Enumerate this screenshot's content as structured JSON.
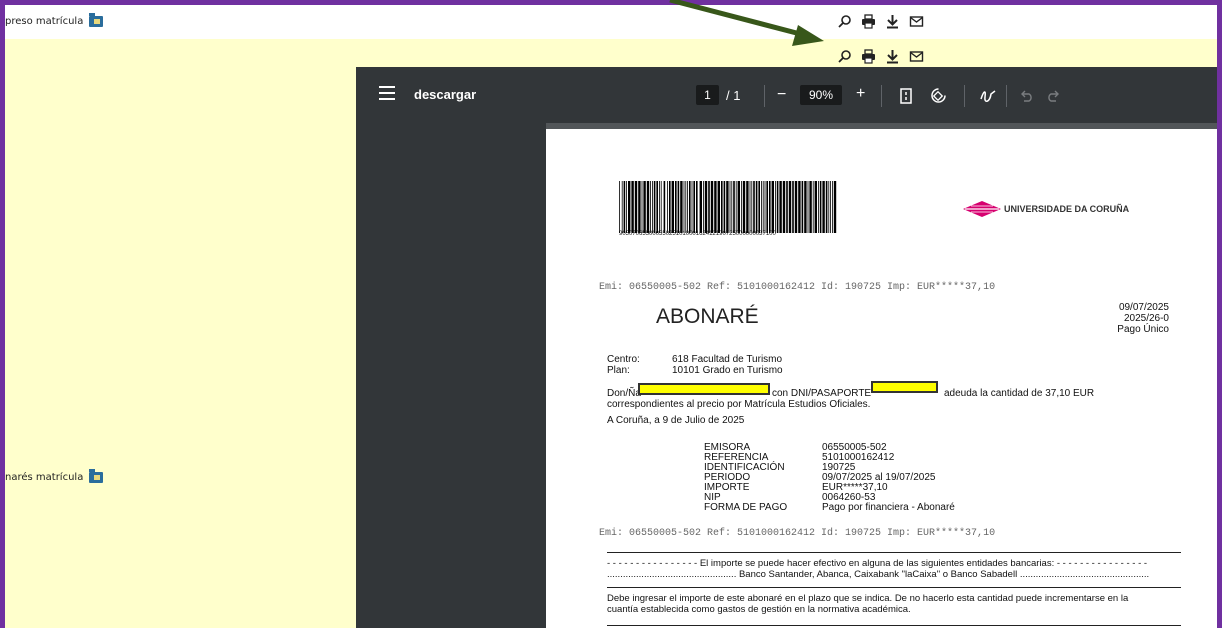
{
  "top": {
    "doc1_label": "preso matrícula",
    "doc2_label": "narés matrícula"
  },
  "icons": [
    "search-icon",
    "print-icon",
    "download-icon",
    "mail-icon"
  ],
  "viewer": {
    "title": "descargar",
    "page_current": "1",
    "page_total": "/ 1",
    "zoom": "90%",
    "zoom_out": "−",
    "zoom_in": "+"
  },
  "pdf": {
    "barcode_number": "90507065500055025101000162412190725000000037100",
    "university": "UNIVERSIDADE DA CORUÑA",
    "emi_line": "Emi: 06550005-502 Ref: 5101000162412 Id: 190725 Imp: EUR*****37,10",
    "heading": "ABONARÉ",
    "date": "09/07/2025",
    "code": "2025/26-0",
    "payment_type": "Pago Único",
    "centro_label": "Centro:",
    "centro_value": "618 Facultad de Turismo",
    "plan_label": "Plan:",
    "plan_value": "10101 Grado en Turismo",
    "don_prefix": "Don/Ña",
    "con_dni": "con DNI/PASAPORTE",
    "adeuda": "adeuda  la  cantidad  de  37,10  EUR",
    "line2": "correspondientes al precio por Matrícula Estudios Oficiales.",
    "place_date": "A Coruña, a 9 de Julio de 2025",
    "fields": [
      {
        "label": "EMISORA",
        "value": "06550005-502"
      },
      {
        "label": "REFERENCIA",
        "value": "5101000162412"
      },
      {
        "label": "IDENTIFICACIÓN",
        "value": "190725"
      },
      {
        "label": "PERIODO",
        "value": "09/07/2025 al 19/07/2025"
      },
      {
        "label": "IMPORTE",
        "value": "EUR*****37,10"
      },
      {
        "label": "NIP",
        "value": "0064260-53"
      },
      {
        "label": "FORMA DE PAGO",
        "value": "Pago por financiera - Abonaré"
      }
    ],
    "banks_line1": "- - - - - - - - - - - - - - - - El importe se puede hacer efectivo en alguna de las siguientes entidades bancarias: - - - - - - - - - - - - - - - -",
    "banks_line2": "................................................. Banco Santander, Abanca, Caixabank \"laCaixa\" o Banco Sabadell .................................................",
    "notice1": "Debe ingresar el importe de este abonaré en el plazo que se indica. De no hacerlo esta cantidad puede incrementarse en la",
    "notice2": "cuantía establecida como gastos de gestión en la normativa académica."
  },
  "colors": {
    "frame": "#7030a0",
    "background": "#ffffcc",
    "arrow": "#38571a",
    "viewer_toolbar": "#323639"
  }
}
